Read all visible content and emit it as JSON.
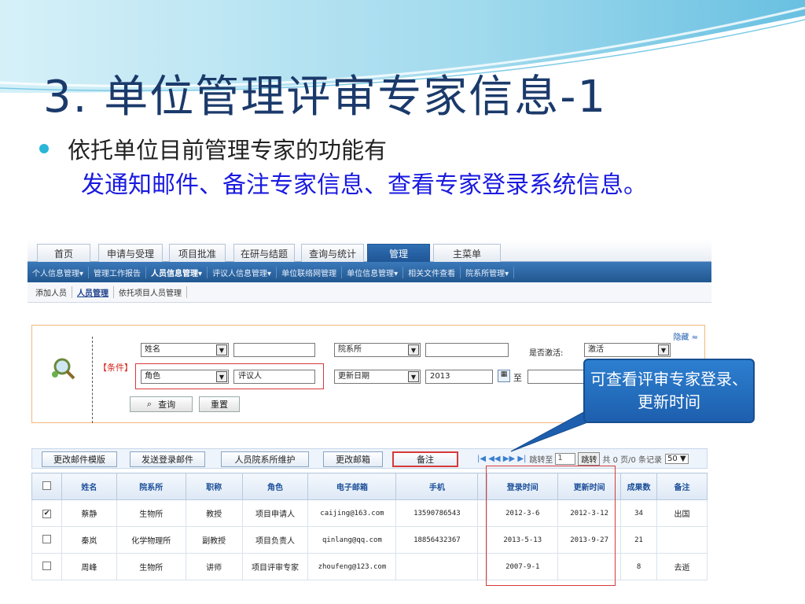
{
  "slide": {
    "title": "3. 单位管理评审专家信息-1",
    "bullet": "依托单位目前管理专家的功能有",
    "detail": "发通知邮件、备注专家信息、查看专家登录系统信息。",
    "callout": "可查看评审专家登录、更新时间"
  },
  "tabs": [
    "首页",
    "申请与受理",
    "项目批准",
    "在研与结题",
    "查询与统计",
    "管理",
    "主菜单"
  ],
  "active_tab": "管理",
  "nav_items": [
    "个人信息管理▾",
    "管理工作报告",
    "人员信息管理▾",
    "评议人信息管理▾",
    "单位联络网管理",
    "单位信息管理▾",
    "相关文件查看",
    "院系所管理▾"
  ],
  "subnav": [
    "添加人员",
    "人员管理",
    "依托项目人员管理"
  ],
  "search": {
    "hide_label": "隐藏 ≈",
    "condition_label": "【条件】",
    "field1_select": "姓名",
    "field1_value": "",
    "field2_select": "院系所",
    "field2_value": "",
    "active_label": "是否激活:",
    "active_select": "激活",
    "role_select": "角色",
    "role_value": "评议人",
    "date_select": "更新日期",
    "date_value": "2013",
    "to_label": "至",
    "date_to_value": "",
    "query_button": "查询",
    "reset_button": "重置"
  },
  "toolbar": {
    "buttons": [
      "更改邮件模版",
      "发送登录邮件",
      "人员院系所维护",
      "更改邮箱",
      "备注"
    ],
    "pager_jump": "跳转至",
    "pager_page": "1",
    "pager_go": "跳转",
    "pager_info": "共 0 页/0 条记录",
    "page_size": "50"
  },
  "table": {
    "headers": [
      "姓名",
      "院系所",
      "职称",
      "角色",
      "电子邮箱",
      "手机",
      "登录时间",
      "更新时间",
      "成果数",
      "备注"
    ],
    "rows": [
      {
        "checked": true,
        "cells": [
          "蔡静",
          "生物所",
          "教授",
          "项目申请人",
          "caijing@163.com",
          "13590786543",
          "2012-3-6",
          "2012-3-12",
          "34",
          "出国"
        ]
      },
      {
        "checked": false,
        "cells": [
          "秦岚",
          "化学物理所",
          "副教授",
          "项目负责人",
          "qinlang@qq.com",
          "18856432367",
          "2013-5-13",
          "2013-9-27",
          "21",
          ""
        ]
      },
      {
        "checked": false,
        "cells": [
          "周峰",
          "生物所",
          "讲师",
          "项目评审专家",
          "zhoufeng@123.com",
          "",
          "2007-9-1",
          "",
          "8",
          "去逝"
        ]
      }
    ]
  },
  "colors": {
    "title": "#1b3a6b",
    "accent": "#29b6d8",
    "detail": "#1a1ae0",
    "nav": "#22578f",
    "highlight": "#d83a3a"
  }
}
